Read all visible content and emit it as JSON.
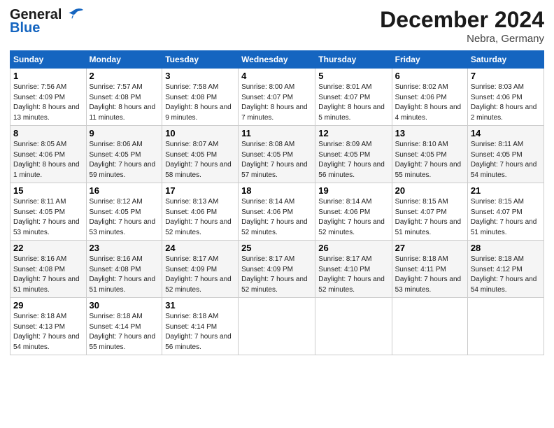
{
  "header": {
    "logo_line1": "General",
    "logo_line2": "Blue",
    "month": "December 2024",
    "location": "Nebra, Germany"
  },
  "days_of_week": [
    "Sunday",
    "Monday",
    "Tuesday",
    "Wednesday",
    "Thursday",
    "Friday",
    "Saturday"
  ],
  "weeks": [
    [
      {
        "day": "1",
        "sunrise": "7:56 AM",
        "sunset": "4:09 PM",
        "daylight": "8 hours and 13 minutes."
      },
      {
        "day": "2",
        "sunrise": "7:57 AM",
        "sunset": "4:08 PM",
        "daylight": "8 hours and 11 minutes."
      },
      {
        "day": "3",
        "sunrise": "7:58 AM",
        "sunset": "4:08 PM",
        "daylight": "8 hours and 9 minutes."
      },
      {
        "day": "4",
        "sunrise": "8:00 AM",
        "sunset": "4:07 PM",
        "daylight": "8 hours and 7 minutes."
      },
      {
        "day": "5",
        "sunrise": "8:01 AM",
        "sunset": "4:07 PM",
        "daylight": "8 hours and 5 minutes."
      },
      {
        "day": "6",
        "sunrise": "8:02 AM",
        "sunset": "4:06 PM",
        "daylight": "8 hours and 4 minutes."
      },
      {
        "day": "7",
        "sunrise": "8:03 AM",
        "sunset": "4:06 PM",
        "daylight": "8 hours and 2 minutes."
      }
    ],
    [
      {
        "day": "8",
        "sunrise": "8:05 AM",
        "sunset": "4:06 PM",
        "daylight": "8 hours and 1 minute."
      },
      {
        "day": "9",
        "sunrise": "8:06 AM",
        "sunset": "4:05 PM",
        "daylight": "7 hours and 59 minutes."
      },
      {
        "day": "10",
        "sunrise": "8:07 AM",
        "sunset": "4:05 PM",
        "daylight": "7 hours and 58 minutes."
      },
      {
        "day": "11",
        "sunrise": "8:08 AM",
        "sunset": "4:05 PM",
        "daylight": "7 hours and 57 minutes."
      },
      {
        "day": "12",
        "sunrise": "8:09 AM",
        "sunset": "4:05 PM",
        "daylight": "7 hours and 56 minutes."
      },
      {
        "day": "13",
        "sunrise": "8:10 AM",
        "sunset": "4:05 PM",
        "daylight": "7 hours and 55 minutes."
      },
      {
        "day": "14",
        "sunrise": "8:11 AM",
        "sunset": "4:05 PM",
        "daylight": "7 hours and 54 minutes."
      }
    ],
    [
      {
        "day": "15",
        "sunrise": "8:11 AM",
        "sunset": "4:05 PM",
        "daylight": "7 hours and 53 minutes."
      },
      {
        "day": "16",
        "sunrise": "8:12 AM",
        "sunset": "4:05 PM",
        "daylight": "7 hours and 53 minutes."
      },
      {
        "day": "17",
        "sunrise": "8:13 AM",
        "sunset": "4:06 PM",
        "daylight": "7 hours and 52 minutes."
      },
      {
        "day": "18",
        "sunrise": "8:14 AM",
        "sunset": "4:06 PM",
        "daylight": "7 hours and 52 minutes."
      },
      {
        "day": "19",
        "sunrise": "8:14 AM",
        "sunset": "4:06 PM",
        "daylight": "7 hours and 52 minutes."
      },
      {
        "day": "20",
        "sunrise": "8:15 AM",
        "sunset": "4:07 PM",
        "daylight": "7 hours and 51 minutes."
      },
      {
        "day": "21",
        "sunrise": "8:15 AM",
        "sunset": "4:07 PM",
        "daylight": "7 hours and 51 minutes."
      }
    ],
    [
      {
        "day": "22",
        "sunrise": "8:16 AM",
        "sunset": "4:08 PM",
        "daylight": "7 hours and 51 minutes."
      },
      {
        "day": "23",
        "sunrise": "8:16 AM",
        "sunset": "4:08 PM",
        "daylight": "7 hours and 51 minutes."
      },
      {
        "day": "24",
        "sunrise": "8:17 AM",
        "sunset": "4:09 PM",
        "daylight": "7 hours and 52 minutes."
      },
      {
        "day": "25",
        "sunrise": "8:17 AM",
        "sunset": "4:09 PM",
        "daylight": "7 hours and 52 minutes."
      },
      {
        "day": "26",
        "sunrise": "8:17 AM",
        "sunset": "4:10 PM",
        "daylight": "7 hours and 52 minutes."
      },
      {
        "day": "27",
        "sunrise": "8:18 AM",
        "sunset": "4:11 PM",
        "daylight": "7 hours and 53 minutes."
      },
      {
        "day": "28",
        "sunrise": "8:18 AM",
        "sunset": "4:12 PM",
        "daylight": "7 hours and 54 minutes."
      }
    ],
    [
      {
        "day": "29",
        "sunrise": "8:18 AM",
        "sunset": "4:13 PM",
        "daylight": "7 hours and 54 minutes."
      },
      {
        "day": "30",
        "sunrise": "8:18 AM",
        "sunset": "4:14 PM",
        "daylight": "7 hours and 55 minutes."
      },
      {
        "day": "31",
        "sunrise": "8:18 AM",
        "sunset": "4:14 PM",
        "daylight": "7 hours and 56 minutes."
      },
      null,
      null,
      null,
      null
    ]
  ]
}
